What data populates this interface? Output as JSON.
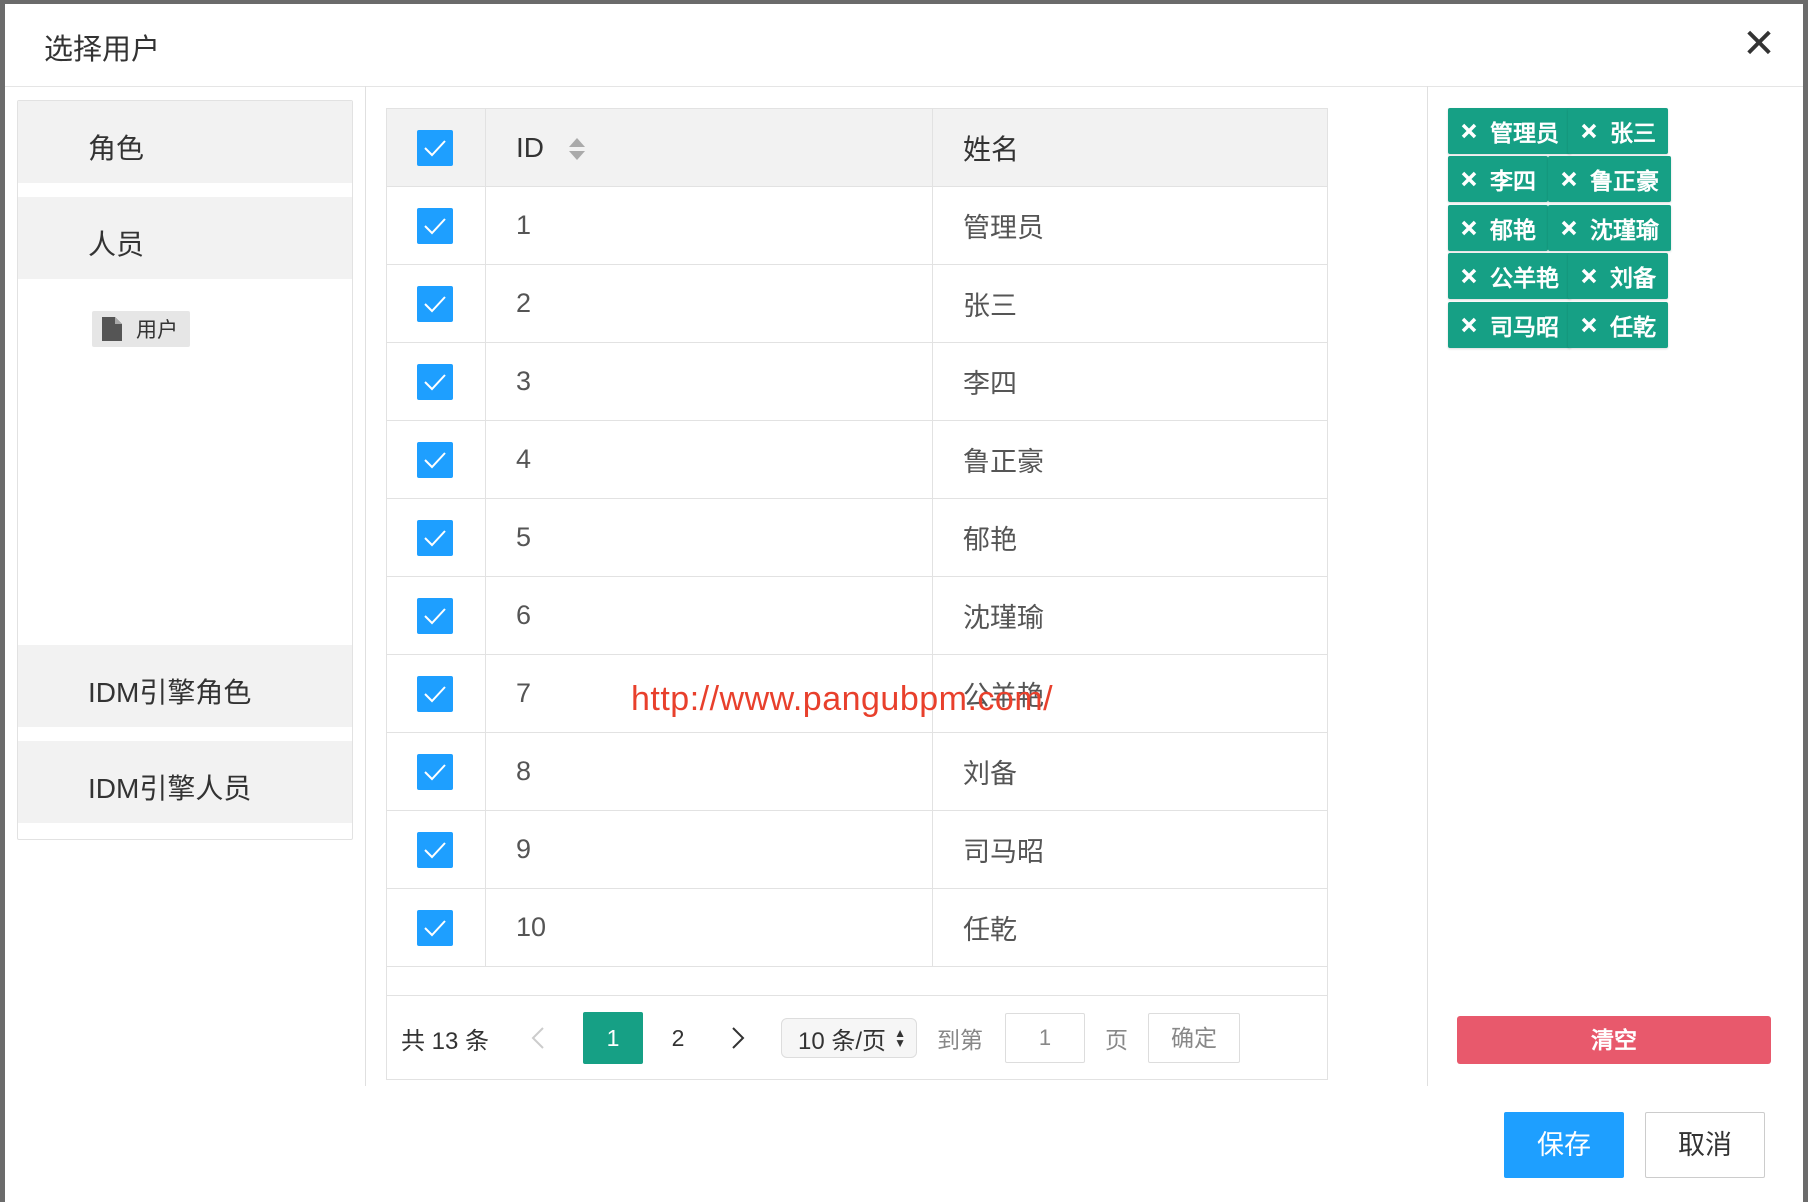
{
  "dialog": {
    "title": "选择用户",
    "close_icon": "close-icon"
  },
  "tree": {
    "groups": [
      {
        "label": "角色"
      },
      {
        "label": "人员"
      },
      {
        "label": "IDM引擎角色"
      },
      {
        "label": "IDM引擎人员"
      }
    ],
    "node": {
      "label": "用户",
      "icon": "file-icon"
    }
  },
  "table": {
    "headers": {
      "id": "ID",
      "name": "姓名"
    },
    "rows": [
      {
        "id": "1",
        "name": "管理员"
      },
      {
        "id": "2",
        "name": "张三"
      },
      {
        "id": "3",
        "name": "李四"
      },
      {
        "id": "4",
        "name": "鲁正豪"
      },
      {
        "id": "5",
        "name": "郁艳"
      },
      {
        "id": "6",
        "name": "沈瑾瑜"
      },
      {
        "id": "7",
        "name": "公羊艳"
      },
      {
        "id": "8",
        "name": "刘备"
      },
      {
        "id": "9",
        "name": "司马昭"
      },
      {
        "id": "10",
        "name": "任乾"
      }
    ]
  },
  "pager": {
    "total": "共 13 条",
    "pages": [
      "1",
      "2"
    ],
    "current": "1",
    "page_size": "10 条/页",
    "goto_label": "到第",
    "goto_value": "1",
    "page_unit": "页",
    "confirm": "确定"
  },
  "selected_tags": [
    "管理员",
    "张三",
    "李四",
    "鲁正豪",
    "郁艳",
    "沈瑾瑜",
    "公羊艳",
    "刘备",
    "司马昭",
    "任乾"
  ],
  "actions": {
    "clear": "清空",
    "save": "保存",
    "cancel": "取消"
  },
  "watermark": "http://www.pangubpm.com/",
  "colors": {
    "primary": "#1e9fff",
    "tag": "#16a085",
    "danger": "#e8596c"
  }
}
